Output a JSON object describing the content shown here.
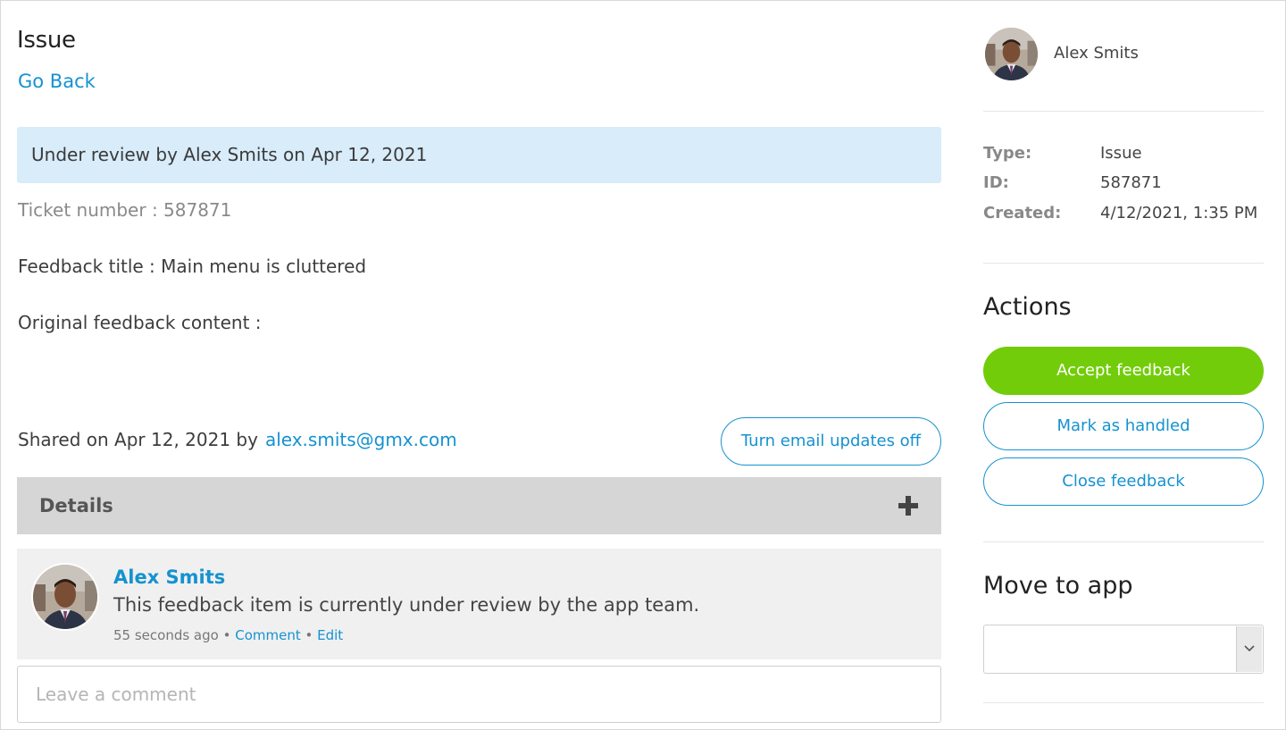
{
  "page": {
    "title": "Issue",
    "back_label": "Go Back",
    "status_banner": "Under review by Alex Smits on Apr 12, 2021",
    "ticket_line": "Ticket number : 587871",
    "feedback_title_line": "Feedback title : Main menu is cluttered",
    "original_content_line": "Original feedback content :",
    "shared_prefix": "Shared on Apr 12, 2021 by",
    "shared_email": "alex.smits@gmx.com",
    "email_toggle_label": "Turn email updates off"
  },
  "details": {
    "label": "Details",
    "icon": "plus-icon"
  },
  "comment": {
    "author": "Alex Smits",
    "text": "This feedback item is currently under review by the app team.",
    "time": "55 seconds ago",
    "separator": " • ",
    "comment_link": "Comment",
    "edit_link": "Edit",
    "avatar_icon": "user-avatar"
  },
  "comment_input": {
    "placeholder": "Leave a comment",
    "value": ""
  },
  "sidebar": {
    "user_name": "Alex Smits",
    "meta": [
      {
        "key": "Type:",
        "value": "Issue"
      },
      {
        "key": "ID:",
        "value": "587871"
      },
      {
        "key": "Created:",
        "value": "4/12/2021, 1:35 PM"
      }
    ],
    "actions_title": "Actions",
    "actions": {
      "accept": "Accept feedback",
      "handled": "Mark as handled",
      "close": "Close feedback"
    },
    "move_title": "Move to app",
    "move_select_value": ""
  },
  "colors": {
    "link_blue": "#1592d0",
    "banner_bg": "#d8ecfa",
    "accept_green": "#72cc0a",
    "details_bg": "#d6d6d6",
    "comment_bg": "#f0f0f0"
  }
}
